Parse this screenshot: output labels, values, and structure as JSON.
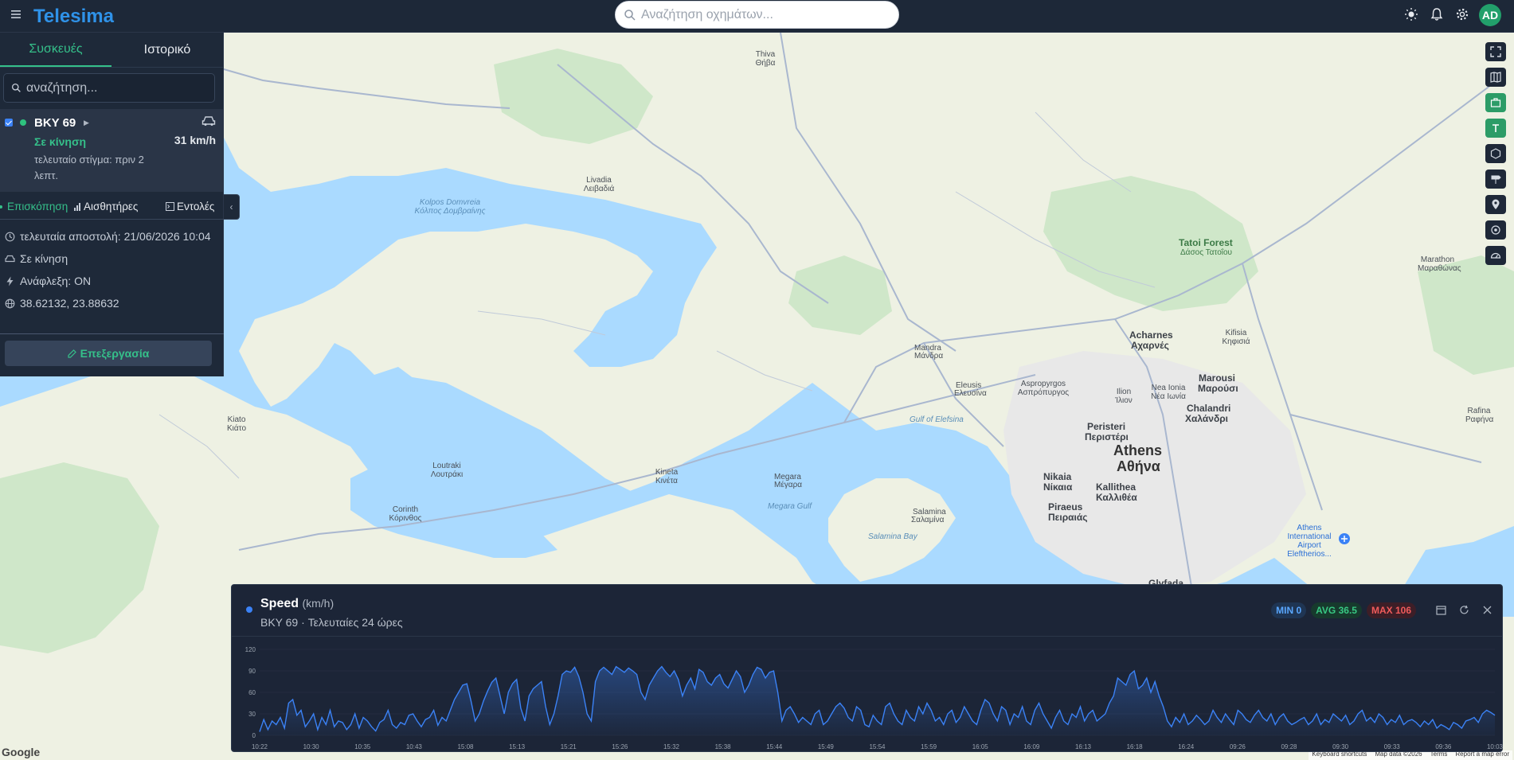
{
  "app": {
    "logo_text": "Telesima",
    "search_placeholder": "Αναζήτηση οχημάτων...",
    "avatar_initials": "AD"
  },
  "sidebar": {
    "tabs": [
      "Συσκευές",
      "Ιστορικό"
    ],
    "search_placeholder": "αναζήτηση...",
    "device": {
      "name": "BKY 69",
      "status": "Σε κίνηση",
      "last_point": "τελευταίο στίγμα: πριν 2 λεπτ.",
      "speed": "31 km/h"
    },
    "subtabs": [
      "Επισκόπηση",
      "Αισθητήρες",
      "Εντολές"
    ],
    "info": {
      "last_sent": "τελευταία αποστολή: 21/06/2026 10:04",
      "motion": "Σε κίνηση",
      "ignition": "Ανάφλεξη: ON",
      "coords": "38.62132, 23.88632"
    },
    "edit_label": "Επεξεργασία"
  },
  "map": {
    "google_label": "Google",
    "attribution": [
      "Keyboard shortcuts",
      "Map data ©2026",
      "Terms",
      "Report a map error"
    ],
    "labels": [
      {
        "t": "Athens",
        "c": "big"
      },
      {
        "t": "Αθήνα",
        "c": "big"
      },
      {
        "t": "Acharnes"
      },
      {
        "t": "Αχαρνές"
      },
      {
        "t": "Marousi"
      },
      {
        "t": "Μαρούσι"
      },
      {
        "t": "Peristeri"
      },
      {
        "t": "Περιστέρι"
      },
      {
        "t": "Chalandri"
      },
      {
        "t": "Χαλάνδρι"
      },
      {
        "t": "Nikaia"
      },
      {
        "t": "Νίκαια"
      },
      {
        "t": "Kallithea"
      },
      {
        "t": "Καλλιθέα"
      },
      {
        "t": "Piraeus"
      },
      {
        "t": "Πειραιάς"
      },
      {
        "t": "Salamina"
      },
      {
        "t": "Σαλαμίνα"
      },
      {
        "t": "Megara"
      },
      {
        "t": "Μέγαρα"
      },
      {
        "t": "Eleusis"
      },
      {
        "t": "Ελευσίνα"
      },
      {
        "t": "Mandra"
      },
      {
        "t": "Μάνδρα"
      },
      {
        "t": "Tatoi Forest"
      },
      {
        "t": "Δάσος Τατοΐου"
      },
      {
        "t": "Athens International Airport Eleftherios..."
      },
      {
        "t": "Glyfada"
      },
      {
        "t": "Gulf of Elefsina"
      },
      {
        "t": "Salamina Bay"
      },
      {
        "t": "Megara Gulf"
      },
      {
        "t": "Kolpos Domvreia Κόλπος Δομβραίνης"
      },
      {
        "t": "Thiva Θήβα"
      },
      {
        "t": "Livadia Λειβαδιά"
      },
      {
        "t": "Kiato Κιάτο"
      },
      {
        "t": "Corinth Κόρινθος"
      },
      {
        "t": "Loutraki Λουτράκι"
      },
      {
        "t": "Kineta Κινέτα"
      },
      {
        "t": "Marathon Μαραθώνας"
      },
      {
        "t": "Rafina Ραφήνα"
      },
      {
        "t": "Kifisia Κηφισιά"
      },
      {
        "t": "Nea Ionia Νέα Ιωνία"
      },
      {
        "t": "Ilion Ίλιον"
      },
      {
        "t": "Aspropyrgos Ασπρόπυργος"
      }
    ]
  },
  "chart_panel": {
    "title": "Speed",
    "unit": "(km/h)",
    "subtitle": "BKY 69 · Τελευταίες 24 ώρες",
    "min_label": "MIN 0",
    "avg_label": "AVG 36.5",
    "max_label": "MAX 106"
  },
  "chart_data": {
    "type": "area",
    "ylim": [
      0,
      120
    ],
    "y_ticks": [
      "0",
      "30",
      "60",
      "90",
      "120"
    ],
    "x_ticks": [
      "10:22",
      "10:30",
      "10:35",
      "10:43",
      "15:08",
      "15:13",
      "15:21",
      "15:26",
      "15:32",
      "15:38",
      "15:44",
      "15:49",
      "15:54",
      "15:59",
      "16:05",
      "16:09",
      "16:13",
      "16:18",
      "16:24",
      "09:26",
      "09:28",
      "09:30",
      "09:33",
      "09:36",
      "10:03"
    ],
    "series": [
      {
        "values": [
          5,
          22,
          8,
          20,
          15,
          25,
          10,
          45,
          50,
          28,
          35,
          12,
          20,
          30,
          8,
          25,
          15,
          35,
          12,
          20,
          18,
          8,
          15,
          30,
          10,
          25,
          20,
          12,
          6,
          18,
          22,
          35,
          15,
          10,
          18,
          15,
          28,
          30,
          20,
          12,
          22,
          25,
          35,
          14,
          25,
          20,
          35,
          50,
          60,
          70,
          72,
          48,
          20,
          30,
          48,
          62,
          74,
          80,
          55,
          30,
          60,
          72,
          78,
          38,
          20,
          55,
          65,
          70,
          75,
          40,
          15,
          30,
          55,
          85,
          90,
          88,
          95,
          82,
          60,
          30,
          20,
          75,
          90,
          95,
          90,
          85,
          96,
          92,
          88,
          94,
          90,
          85,
          60,
          50,
          70,
          80,
          90,
          96,
          88,
          82,
          90,
          78,
          55,
          70,
          80,
          65,
          92,
          88,
          75,
          70,
          80,
          85,
          72,
          66,
          78,
          90,
          82,
          60,
          70,
          85,
          95,
          92,
          80,
          88,
          90,
          60,
          20,
          35,
          40,
          30,
          18,
          25,
          20,
          15,
          30,
          35,
          15,
          20,
          30,
          40,
          45,
          38,
          25,
          20,
          40,
          35,
          15,
          12,
          28,
          20,
          15,
          40,
          45,
          30,
          20,
          15,
          35,
          25,
          20,
          40,
          30,
          45,
          35,
          20,
          25,
          15,
          30,
          35,
          18,
          25,
          40,
          30,
          20,
          15,
          35,
          50,
          45,
          30,
          20,
          40,
          35,
          15,
          30,
          25,
          40,
          20,
          15,
          35,
          45,
          30,
          20,
          10,
          25,
          35,
          20,
          15,
          30,
          25,
          40,
          20,
          30,
          35,
          20,
          25,
          30,
          45,
          55,
          80,
          75,
          70,
          85,
          90,
          65,
          70,
          80,
          60,
          75,
          55,
          40,
          20,
          12,
          25,
          18,
          30,
          15,
          20,
          28,
          22,
          15,
          20,
          35,
          25,
          18,
          30,
          22,
          15,
          35,
          30,
          22,
          18,
          28,
          35,
          25,
          20,
          30,
          15,
          25,
          30,
          20,
          15,
          18,
          22,
          25,
          15,
          20,
          30,
          15,
          22,
          18,
          30,
          25,
          20,
          28,
          15,
          20,
          30,
          35,
          20,
          25,
          18,
          30,
          25,
          15,
          22,
          18,
          28,
          15,
          20,
          22,
          18,
          12,
          20,
          15,
          22,
          10,
          15,
          12,
          8,
          18,
          15,
          10,
          20,
          22,
          25,
          18,
          30,
          35,
          32,
          28
        ]
      }
    ]
  }
}
